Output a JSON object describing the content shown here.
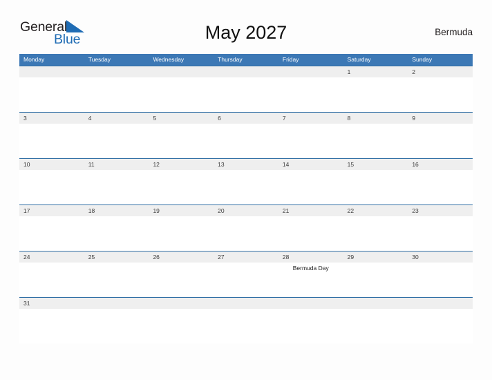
{
  "brand": {
    "name_part1": "General",
    "name_part2": "Blue",
    "flag_icon": "blue-flag-triangle",
    "color_dark": "#231f20",
    "color_blue": "#1f6cb4"
  },
  "header": {
    "title": "May 2027",
    "country": "Bermuda"
  },
  "calendar": {
    "accent_color": "#3c78b5",
    "line_color": "#2e6da4",
    "band_color": "#efefef",
    "weekday_headers": [
      "Monday",
      "Tuesday",
      "Wednesday",
      "Thursday",
      "Friday",
      "Saturday",
      "Sunday"
    ],
    "weeks": [
      {
        "days": [
          {
            "num": "",
            "event": ""
          },
          {
            "num": "",
            "event": ""
          },
          {
            "num": "",
            "event": ""
          },
          {
            "num": "",
            "event": ""
          },
          {
            "num": "",
            "event": ""
          },
          {
            "num": "1",
            "event": ""
          },
          {
            "num": "2",
            "event": ""
          }
        ]
      },
      {
        "days": [
          {
            "num": "3",
            "event": ""
          },
          {
            "num": "4",
            "event": ""
          },
          {
            "num": "5",
            "event": ""
          },
          {
            "num": "6",
            "event": ""
          },
          {
            "num": "7",
            "event": ""
          },
          {
            "num": "8",
            "event": ""
          },
          {
            "num": "9",
            "event": ""
          }
        ]
      },
      {
        "days": [
          {
            "num": "10",
            "event": ""
          },
          {
            "num": "11",
            "event": ""
          },
          {
            "num": "12",
            "event": ""
          },
          {
            "num": "13",
            "event": ""
          },
          {
            "num": "14",
            "event": ""
          },
          {
            "num": "15",
            "event": ""
          },
          {
            "num": "16",
            "event": ""
          }
        ]
      },
      {
        "days": [
          {
            "num": "17",
            "event": ""
          },
          {
            "num": "18",
            "event": ""
          },
          {
            "num": "19",
            "event": ""
          },
          {
            "num": "20",
            "event": ""
          },
          {
            "num": "21",
            "event": ""
          },
          {
            "num": "22",
            "event": ""
          },
          {
            "num": "23",
            "event": ""
          }
        ]
      },
      {
        "days": [
          {
            "num": "24",
            "event": ""
          },
          {
            "num": "25",
            "event": ""
          },
          {
            "num": "26",
            "event": ""
          },
          {
            "num": "27",
            "event": ""
          },
          {
            "num": "28",
            "event": "Bermuda Day"
          },
          {
            "num": "29",
            "event": ""
          },
          {
            "num": "30",
            "event": ""
          }
        ]
      },
      {
        "days": [
          {
            "num": "31",
            "event": ""
          },
          {
            "num": "",
            "event": ""
          },
          {
            "num": "",
            "event": ""
          },
          {
            "num": "",
            "event": ""
          },
          {
            "num": "",
            "event": ""
          },
          {
            "num": "",
            "event": ""
          },
          {
            "num": "",
            "event": ""
          }
        ]
      }
    ]
  }
}
